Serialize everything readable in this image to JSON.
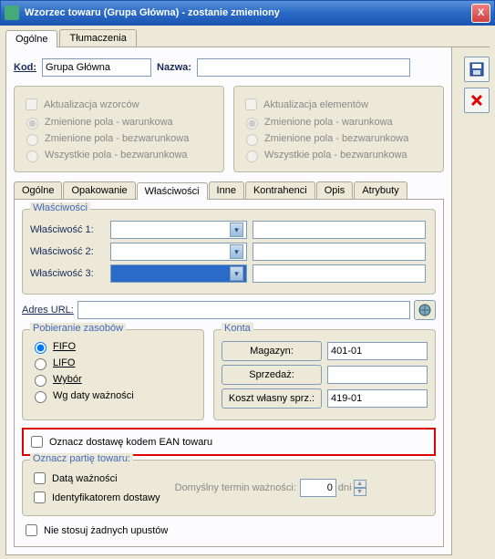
{
  "window": {
    "title": "Wzorzec towaru (Grupa Główna) - zostanie zmieniony",
    "close": "X"
  },
  "topTabs": {
    "t1": "Ogólne",
    "t2": "Tłumaczenia"
  },
  "header": {
    "kodLabel": "Kod:",
    "kodValue": "Grupa Główna",
    "nazwaLabel": "Nazwa:",
    "nazwaValue": ""
  },
  "update": {
    "wz": {
      "chk": "Aktualizacja wzorców",
      "r1": "Zmienione pola - warunkowa",
      "r2": "Zmienione pola - bezwarunkowa",
      "r3": "Wszystkie pola - bezwarunkowa"
    },
    "el": {
      "chk": "Aktualizacja elementów",
      "r1": "Zmienione pola - warunkowa",
      "r2": "Zmienione pola - bezwarunkowa",
      "r3": "Wszystkie pola - bezwarunkowa"
    }
  },
  "tabs2": {
    "t1": "Ogólne",
    "t2": "Opakowanie",
    "t3": "Właściwości",
    "t4": "Inne",
    "t5": "Kontrahenci",
    "t6": "Opis",
    "t7": "Atrybuty"
  },
  "props": {
    "title": "Właściwości",
    "p1l": "Właściwość 1:",
    "p1v": "",
    "p2l": "Właściwość 2:",
    "p2v": "",
    "p3l": "Właściwość 3:",
    "p3v": ""
  },
  "url": {
    "label": "Adres URL:",
    "value": ""
  },
  "fetch": {
    "title": "Pobieranie zasobów",
    "r1": "FIFO",
    "r2": "LIFO",
    "r3": "Wybór",
    "r4": "Wg daty ważności"
  },
  "konta": {
    "title": "Konta",
    "b1": "Magazyn:",
    "v1": "401-01",
    "b2": "Sprzedaż:",
    "v2": "",
    "b3": "Koszt własny sprz.:",
    "v3": "419-01"
  },
  "ean": {
    "label": "Oznacz dostawę kodem EAN towaru"
  },
  "batch": {
    "title": "Oznacz partię towaru:",
    "c1": "Datą ważności",
    "c2": "Identyfikatorem dostawy",
    "expLabel": "Domyślny termin ważności:",
    "expVal": "0",
    "expUnit": "dni"
  },
  "discount": {
    "label": "Nie stosuj żadnych upustów"
  }
}
